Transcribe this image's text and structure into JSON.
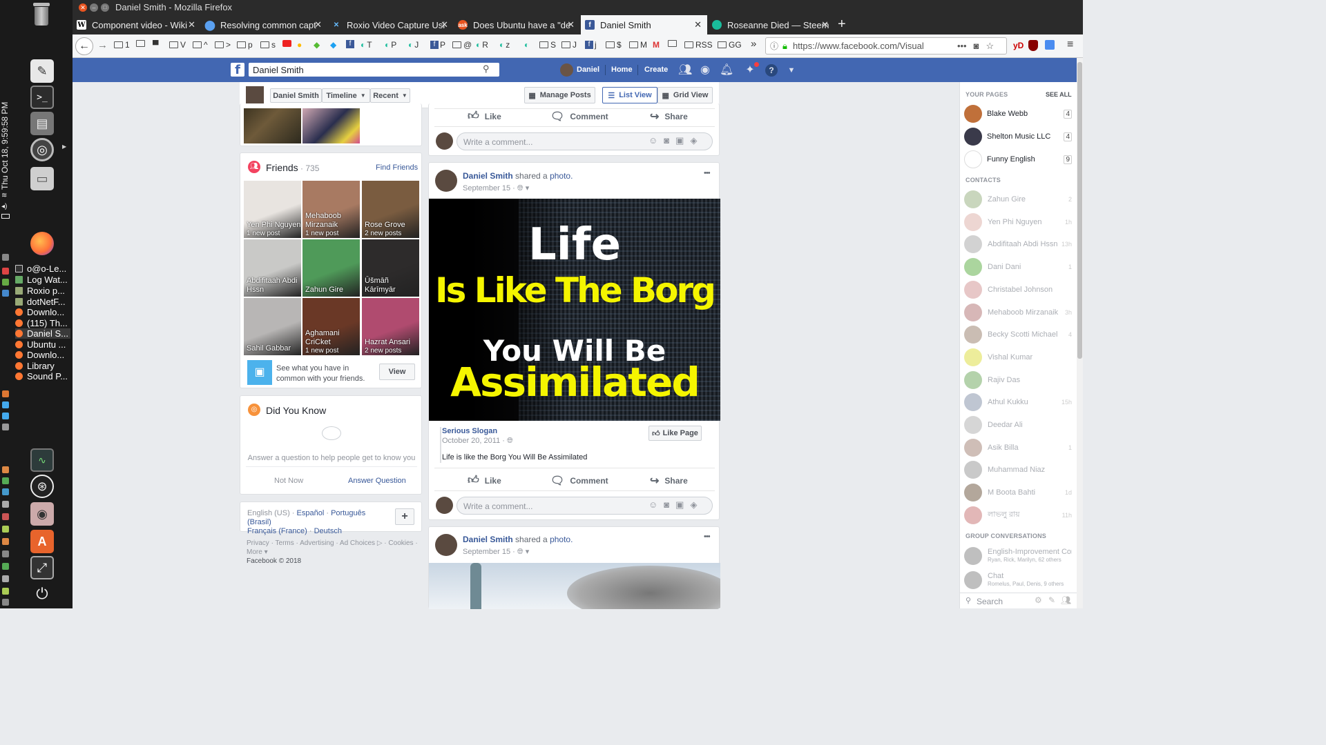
{
  "desktop": {
    "clock": "Thu Oct 18,  9:59:58 PM",
    "dock_windows": [
      "o@o-Le...",
      "Log Wat...",
      "Roxio p...",
      "dotNetF...",
      "Downlo...",
      "(115) Th...",
      "Daniel S...",
      "Ubuntu ...",
      "Downlo...",
      "Library",
      "Sound P..."
    ]
  },
  "window": {
    "title": "Daniel Smith - Mozilla Firefox"
  },
  "tabs": [
    {
      "label": "Component video - Wiki"
    },
    {
      "label": "Resolving common capt"
    },
    {
      "label": "Roxio Video Capture Usi"
    },
    {
      "label": "Does Ubuntu have a \"de"
    },
    {
      "label": "Daniel Smith"
    },
    {
      "label": "Roseanne Died — Steem"
    }
  ],
  "new_tab": "+",
  "bookmarks": [
    "1",
    "",
    "",
    "V",
    "^",
    ">",
    "p",
    "s",
    "",
    "",
    "",
    "",
    "T",
    "P",
    "J",
    "P",
    "@",
    "R",
    "z",
    "",
    "S",
    "J",
    "j",
    "$",
    "M",
    "",
    "RSS",
    "GG"
  ],
  "url": "https://www.facebook.com/Visual",
  "toolbar_text": {
    "yd": "yD",
    "overflow": "»",
    "more": "•••",
    "menu": "≡"
  },
  "fb": {
    "search_value": "Daniel Smith",
    "nav": {
      "profile": "Daniel",
      "home": "Home",
      "create": "Create"
    },
    "timeline_bar": {
      "name": "Daniel Smith",
      "timeline": "Timeline",
      "recent": "Recent",
      "manage_posts": "Manage Posts",
      "list_view": "List View",
      "grid_view": "Grid View"
    },
    "friends": {
      "title": "Friends",
      "count": " · 735",
      "find": "Find Friends",
      "items": [
        {
          "name": "Yen Phi Nguyen",
          "note": "1 new post",
          "color": "#e8e4e0"
        },
        {
          "name": "Mehaboob Mirzanaik",
          "note": "1 new post",
          "color": "#a87a62"
        },
        {
          "name": "Rose Grove",
          "note": "2 new posts",
          "color": "#7a5c40"
        },
        {
          "name": "Abdifitaah Abdi Hssn",
          "note": "",
          "color": "#c9c9c7"
        },
        {
          "name": "Zahun Gire",
          "note": "",
          "color": "#4f9a59"
        },
        {
          "name": "Ūšmāñ Kārīmyār",
          "note": "",
          "color": "#2d2b2b"
        },
        {
          "name": "Sahil Gabbar",
          "note": "",
          "color": "#b8b6b5"
        },
        {
          "name": "Aghamani CriCket",
          "note": "1 new post",
          "color": "#6a3826"
        },
        {
          "name": "Hazrat Ansari",
          "note": "2 new posts",
          "color": "#b04b6f"
        }
      ],
      "common_text": "See what you have in common with your friends.",
      "view_btn": "View"
    },
    "dyk": {
      "title": "Did You Know",
      "prompt": "Answer a question to help people get to know you",
      "not_now": "Not Now",
      "answer": "Answer Question"
    },
    "languages": {
      "current": "English (US)",
      "list": [
        "Español",
        "Português (Brasil)",
        "Français (France)",
        "Deutsch"
      ],
      "plus": "+"
    },
    "footer": {
      "links": [
        "Privacy",
        "Terms",
        "Advertising",
        "Ad Choices",
        "Cookies",
        "More"
      ],
      "copyright": "Facebook © 2018"
    },
    "actions": {
      "like": "Like",
      "comment": "Comment",
      "share": "Share",
      "write_comment": "Write a comment..."
    },
    "post1": {
      "author": "Daniel Smith",
      "shared": "shared a",
      "photo": "photo.",
      "date": "September 15",
      "image_lines": [
        "Life",
        "Is Like The Borg",
        "You Will Be",
        "Assimilated"
      ],
      "page_name": "Serious Slogan",
      "page_date": "October 20, 2011",
      "like_page": "Like Page",
      "caption": "Life is like the Borg You Will Be Assimilated",
      "more": "•••"
    },
    "post2": {
      "author": "Daniel Smith",
      "shared": "shared a",
      "photo": "photo.",
      "date": "September 15",
      "more": "•••"
    },
    "sidebar": {
      "your_pages": "YOUR PAGES",
      "see_all": "SEE ALL",
      "pages": [
        {
          "name": "Blake Webb",
          "count": "4",
          "color": "#c0703a"
        },
        {
          "name": "Shelton Music LLC",
          "count": "4",
          "color": "#3a3a4a"
        },
        {
          "name": "Funny English",
          "count": "9",
          "color": "#ffffff"
        }
      ],
      "contacts_head": "CONTACTS",
      "contacts": [
        {
          "name": "Zahun Gire",
          "status": "2"
        },
        {
          "name": "Yen Phi Nguyen",
          "status": "1h"
        },
        {
          "name": "Abdifitaah Abdi Hssn",
          "status": "13h"
        },
        {
          "name": "Dani Dani",
          "status": "1"
        },
        {
          "name": "Christabel Johnson",
          "status": ""
        },
        {
          "name": "Mehaboob Mirzanaik",
          "status": "3h"
        },
        {
          "name": "Becky Scotti Michael",
          "status": "4"
        },
        {
          "name": "Vishal Kumar",
          "status": ""
        },
        {
          "name": "Rajiv Das",
          "status": ""
        },
        {
          "name": "Athul Kukku",
          "status": "15h"
        },
        {
          "name": "Deedar Ali",
          "status": ""
        },
        {
          "name": "Asik Billa",
          "status": "1"
        },
        {
          "name": "Muhammad Niaz",
          "status": ""
        },
        {
          "name": "M Boota Bahti",
          "status": "1d"
        },
        {
          "name": "লাভলু রায়",
          "status": "11h"
        }
      ],
      "group_head": "GROUP CONVERSATIONS",
      "groups": [
        {
          "name": "English-Improvement Con...",
          "sub": "Ryan, Rick, Marilyn, 62 others"
        },
        {
          "name": "Chat",
          "sub": "Romelus, Paul, Denis, 9 others"
        }
      ],
      "search_placeholder": "Search"
    }
  }
}
